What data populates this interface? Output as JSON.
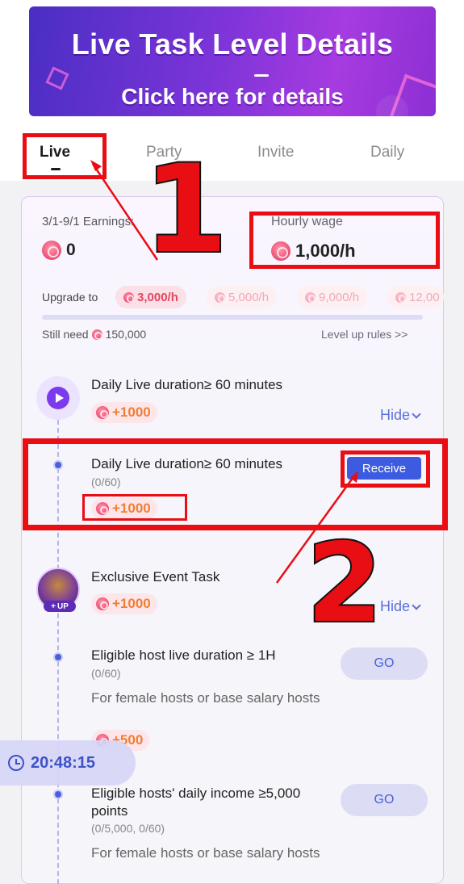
{
  "banner": {
    "title": "Live Task Level Details",
    "dash": "—",
    "subtitle": "Click here for details"
  },
  "tabs": [
    {
      "label": "Live",
      "active": true
    },
    {
      "label": "Party",
      "active": false
    },
    {
      "label": "Invite",
      "active": false
    },
    {
      "label": "Daily",
      "active": false
    }
  ],
  "summary": {
    "earnings_label": "3/1-9/1 Earnings:",
    "earnings_value": "0",
    "wage_label": "Hourly wage",
    "wage_value": "1,000/h",
    "upgrade_label": "Upgrade to",
    "upgrade_levels": [
      "3,000/h",
      "5,000/h",
      "9,000/h",
      "12,00"
    ],
    "progress_fraction": 0,
    "still_need_label": "Still need",
    "still_need_value": "150,000",
    "level_rules_link": "Level up rules >>"
  },
  "tasks": {
    "daily_live": {
      "title": "Daily Live duration≥ 60 minutes",
      "reward": "+1000",
      "hide_label": "Hide",
      "subtask": {
        "title": "Daily Live duration≥ 60 minutes",
        "progress": "(0/60)",
        "reward": "+1000",
        "button": "Receive"
      }
    },
    "exclusive_event": {
      "title": "Exclusive Event Task",
      "reward": "+1000",
      "hide_label": "Hide",
      "avatar_badge": "UP",
      "subtasks": [
        {
          "title": "Eligible host live duration ≥ 1H",
          "progress": "(0/60)",
          "desc": "For female hosts or base salary hosts",
          "reward": "+500",
          "button": "GO"
        },
        {
          "title": "Eligible hosts' daily income ≥5,000 points",
          "progress": "(0/5,000, 0/60)",
          "desc": "For female hosts or base salary hosts",
          "button": "GO"
        }
      ]
    }
  },
  "timer": "20:48:15",
  "annotations": {
    "num1": "1",
    "num2": "2"
  },
  "colors": {
    "accent": "#3d5be0",
    "reward_text": "#ef7f34",
    "annotation_red": "#e80e14",
    "banner_purple": "#7b34d8"
  }
}
